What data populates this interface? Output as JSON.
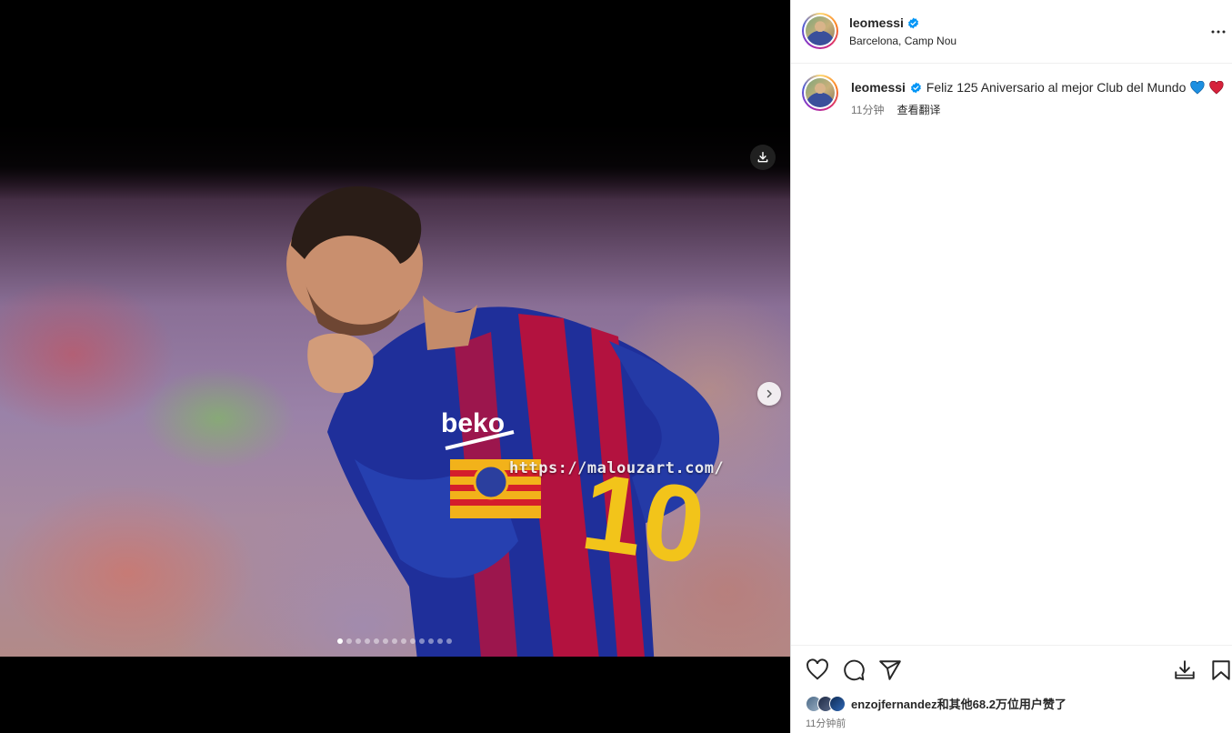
{
  "post": {
    "username": "leomessi",
    "verified": true,
    "location": "Barcelona, Camp Nou",
    "watermark": "https://malouzart.com/",
    "carousel": {
      "total_slides": 13,
      "current_slide": 1
    }
  },
  "caption": {
    "username": "leomessi",
    "text": "Feliz 125 Aniversario al mejor Club del Mundo",
    "emojis": [
      "blue-heart-icon",
      "red-heart-icon"
    ],
    "time": "11分钟",
    "translate_label": "查看翻译"
  },
  "likes": {
    "text": "enzojfernandez和其他68.2万位用户赞了",
    "avatar_count": 3
  },
  "timestamp": "11分钟前",
  "colors": {
    "verified": "#0095f6",
    "blue_heart": "#1d8fe1",
    "red_heart": "#d6213b",
    "text": "#262626",
    "muted": "#737373"
  },
  "icons": {
    "download": "download-icon",
    "next": "chevron-right-icon",
    "more": "more-options-icon",
    "like": "heart-outline-icon",
    "comment": "comment-icon",
    "share": "send-icon",
    "save_to_collection": "download-tray-icon",
    "bookmark": "bookmark-icon"
  }
}
